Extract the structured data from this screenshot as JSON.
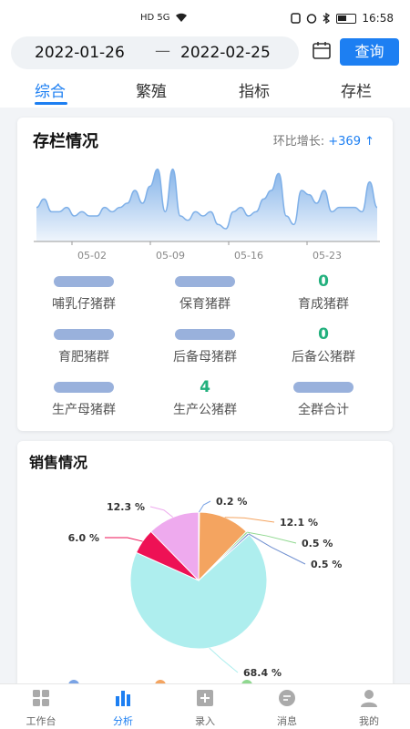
{
  "status": {
    "left_icons": "HD 5G",
    "time": "16:58"
  },
  "header": {
    "start_date": "2022-01-26",
    "separator": "—",
    "end_date": "2022-02-25",
    "query_label": "查询"
  },
  "tabs": [
    {
      "label": "综合",
      "active": true
    },
    {
      "label": "繁殖",
      "active": false
    },
    {
      "label": "指标",
      "active": false
    },
    {
      "label": "存栏",
      "active": false
    }
  ],
  "stock": {
    "title": "存栏情况",
    "growth_label": "环比增长:",
    "growth_value": "+369 ↑",
    "chart_data": {
      "type": "area",
      "x_ticks": [
        "05-02",
        "05-09",
        "05-16",
        "05-23"
      ],
      "values": [
        16,
        18,
        15,
        15,
        16,
        14,
        15,
        14,
        14,
        16,
        15,
        16,
        17,
        20,
        17,
        21,
        25,
        15,
        25,
        14,
        13,
        15,
        14,
        15,
        12,
        11,
        15,
        16,
        14,
        15,
        18,
        20,
        24,
        14,
        12,
        20,
        19,
        17,
        20,
        15,
        16,
        16,
        16,
        15,
        22,
        16
      ],
      "color": "#7fb0e8"
    },
    "items": [
      {
        "value": "4636",
        "label": "哺乳仔猪群",
        "blurred": true
      },
      {
        "value": "3692",
        "label": "保育猪群",
        "blurred": true
      },
      {
        "value": "0",
        "label": "育成猪群",
        "blurred": false
      },
      {
        "value": "",
        "label": "育肥猪群",
        "blurred": true
      },
      {
        "value": "",
        "label": "后备母猪群",
        "blurred": true
      },
      {
        "value": "0",
        "label": "后备公猪群",
        "blurred": false
      },
      {
        "value": "1503",
        "label": "生产母猪群",
        "blurred": true
      },
      {
        "value": "4",
        "label": "生产公猪群",
        "blurred": false
      },
      {
        "value": "",
        "label": "全群合计",
        "blurred": true
      }
    ]
  },
  "sales": {
    "title": "销售情况",
    "chart_data": {
      "type": "pie",
      "slices": [
        {
          "percent": 0.2,
          "label": "0.2 %",
          "color": "#7aa3e5"
        },
        {
          "percent": 12.1,
          "label": "12.1 %",
          "color": "#f4a460"
        },
        {
          "percent": 0.5,
          "label": "0.5 %",
          "color": "#8fd88f"
        },
        {
          "percent": 0.5,
          "label": "0.5 %",
          "color": "#6f8fd0"
        },
        {
          "percent": 68.4,
          "label": "68.4 %",
          "color": "#aeeeee"
        },
        {
          "percent": 6.0,
          "label": "6.0 %",
          "color": "#ee1155"
        },
        {
          "percent": 12.3,
          "label": "12.3 %",
          "color": "#eeaaee"
        }
      ]
    }
  },
  "nav": [
    {
      "label": "工作台",
      "icon": "workbench-icon",
      "active": false
    },
    {
      "label": "分析",
      "icon": "analysis-icon",
      "active": true
    },
    {
      "label": "录入",
      "icon": "entry-icon",
      "active": false
    },
    {
      "label": "消息",
      "icon": "message-icon",
      "active": false
    },
    {
      "label": "我的",
      "icon": "profile-icon",
      "active": false
    }
  ]
}
